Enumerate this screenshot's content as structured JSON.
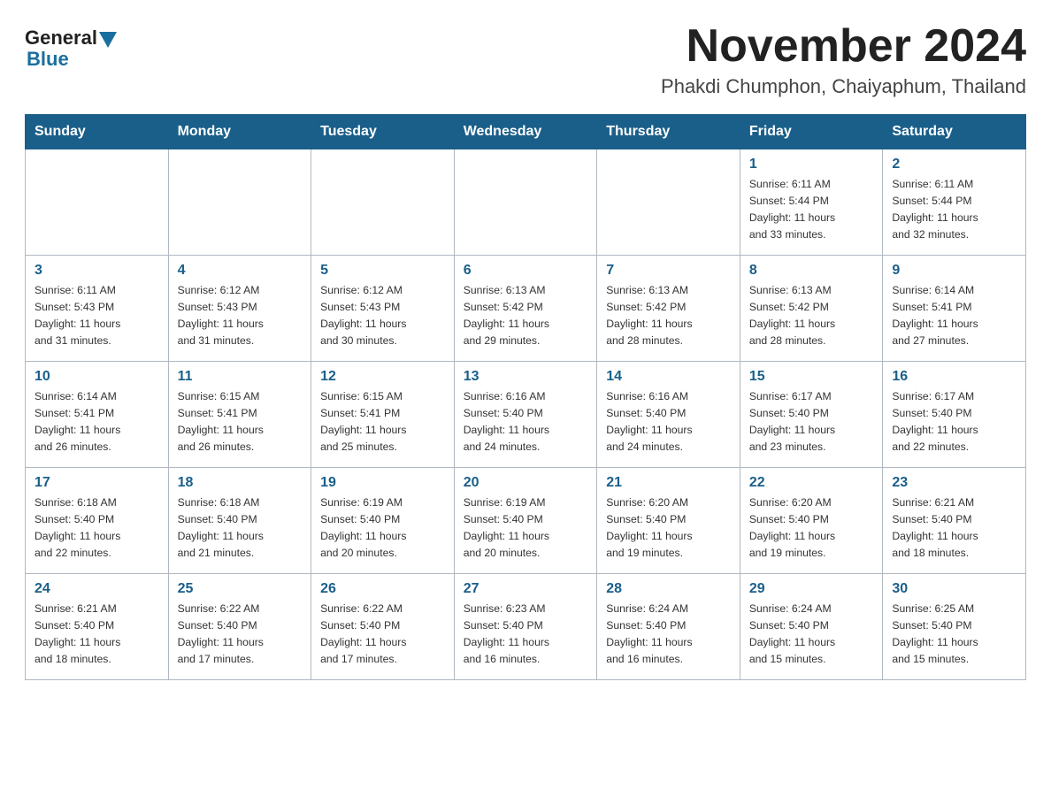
{
  "logo": {
    "general": "General",
    "blue": "Blue"
  },
  "header": {
    "month": "November 2024",
    "location": "Phakdi Chumphon, Chaiyaphum, Thailand"
  },
  "weekdays": [
    "Sunday",
    "Monday",
    "Tuesday",
    "Wednesday",
    "Thursday",
    "Friday",
    "Saturday"
  ],
  "weeks": [
    [
      {
        "day": "",
        "info": ""
      },
      {
        "day": "",
        "info": ""
      },
      {
        "day": "",
        "info": ""
      },
      {
        "day": "",
        "info": ""
      },
      {
        "day": "",
        "info": ""
      },
      {
        "day": "1",
        "info": "Sunrise: 6:11 AM\nSunset: 5:44 PM\nDaylight: 11 hours\nand 33 minutes."
      },
      {
        "day": "2",
        "info": "Sunrise: 6:11 AM\nSunset: 5:44 PM\nDaylight: 11 hours\nand 32 minutes."
      }
    ],
    [
      {
        "day": "3",
        "info": "Sunrise: 6:11 AM\nSunset: 5:43 PM\nDaylight: 11 hours\nand 31 minutes."
      },
      {
        "day": "4",
        "info": "Sunrise: 6:12 AM\nSunset: 5:43 PM\nDaylight: 11 hours\nand 31 minutes."
      },
      {
        "day": "5",
        "info": "Sunrise: 6:12 AM\nSunset: 5:43 PM\nDaylight: 11 hours\nand 30 minutes."
      },
      {
        "day": "6",
        "info": "Sunrise: 6:13 AM\nSunset: 5:42 PM\nDaylight: 11 hours\nand 29 minutes."
      },
      {
        "day": "7",
        "info": "Sunrise: 6:13 AM\nSunset: 5:42 PM\nDaylight: 11 hours\nand 28 minutes."
      },
      {
        "day": "8",
        "info": "Sunrise: 6:13 AM\nSunset: 5:42 PM\nDaylight: 11 hours\nand 28 minutes."
      },
      {
        "day": "9",
        "info": "Sunrise: 6:14 AM\nSunset: 5:41 PM\nDaylight: 11 hours\nand 27 minutes."
      }
    ],
    [
      {
        "day": "10",
        "info": "Sunrise: 6:14 AM\nSunset: 5:41 PM\nDaylight: 11 hours\nand 26 minutes."
      },
      {
        "day": "11",
        "info": "Sunrise: 6:15 AM\nSunset: 5:41 PM\nDaylight: 11 hours\nand 26 minutes."
      },
      {
        "day": "12",
        "info": "Sunrise: 6:15 AM\nSunset: 5:41 PM\nDaylight: 11 hours\nand 25 minutes."
      },
      {
        "day": "13",
        "info": "Sunrise: 6:16 AM\nSunset: 5:40 PM\nDaylight: 11 hours\nand 24 minutes."
      },
      {
        "day": "14",
        "info": "Sunrise: 6:16 AM\nSunset: 5:40 PM\nDaylight: 11 hours\nand 24 minutes."
      },
      {
        "day": "15",
        "info": "Sunrise: 6:17 AM\nSunset: 5:40 PM\nDaylight: 11 hours\nand 23 minutes."
      },
      {
        "day": "16",
        "info": "Sunrise: 6:17 AM\nSunset: 5:40 PM\nDaylight: 11 hours\nand 22 minutes."
      }
    ],
    [
      {
        "day": "17",
        "info": "Sunrise: 6:18 AM\nSunset: 5:40 PM\nDaylight: 11 hours\nand 22 minutes."
      },
      {
        "day": "18",
        "info": "Sunrise: 6:18 AM\nSunset: 5:40 PM\nDaylight: 11 hours\nand 21 minutes."
      },
      {
        "day": "19",
        "info": "Sunrise: 6:19 AM\nSunset: 5:40 PM\nDaylight: 11 hours\nand 20 minutes."
      },
      {
        "day": "20",
        "info": "Sunrise: 6:19 AM\nSunset: 5:40 PM\nDaylight: 11 hours\nand 20 minutes."
      },
      {
        "day": "21",
        "info": "Sunrise: 6:20 AM\nSunset: 5:40 PM\nDaylight: 11 hours\nand 19 minutes."
      },
      {
        "day": "22",
        "info": "Sunrise: 6:20 AM\nSunset: 5:40 PM\nDaylight: 11 hours\nand 19 minutes."
      },
      {
        "day": "23",
        "info": "Sunrise: 6:21 AM\nSunset: 5:40 PM\nDaylight: 11 hours\nand 18 minutes."
      }
    ],
    [
      {
        "day": "24",
        "info": "Sunrise: 6:21 AM\nSunset: 5:40 PM\nDaylight: 11 hours\nand 18 minutes."
      },
      {
        "day": "25",
        "info": "Sunrise: 6:22 AM\nSunset: 5:40 PM\nDaylight: 11 hours\nand 17 minutes."
      },
      {
        "day": "26",
        "info": "Sunrise: 6:22 AM\nSunset: 5:40 PM\nDaylight: 11 hours\nand 17 minutes."
      },
      {
        "day": "27",
        "info": "Sunrise: 6:23 AM\nSunset: 5:40 PM\nDaylight: 11 hours\nand 16 minutes."
      },
      {
        "day": "28",
        "info": "Sunrise: 6:24 AM\nSunset: 5:40 PM\nDaylight: 11 hours\nand 16 minutes."
      },
      {
        "day": "29",
        "info": "Sunrise: 6:24 AM\nSunset: 5:40 PM\nDaylight: 11 hours\nand 15 minutes."
      },
      {
        "day": "30",
        "info": "Sunrise: 6:25 AM\nSunset: 5:40 PM\nDaylight: 11 hours\nand 15 minutes."
      }
    ]
  ]
}
